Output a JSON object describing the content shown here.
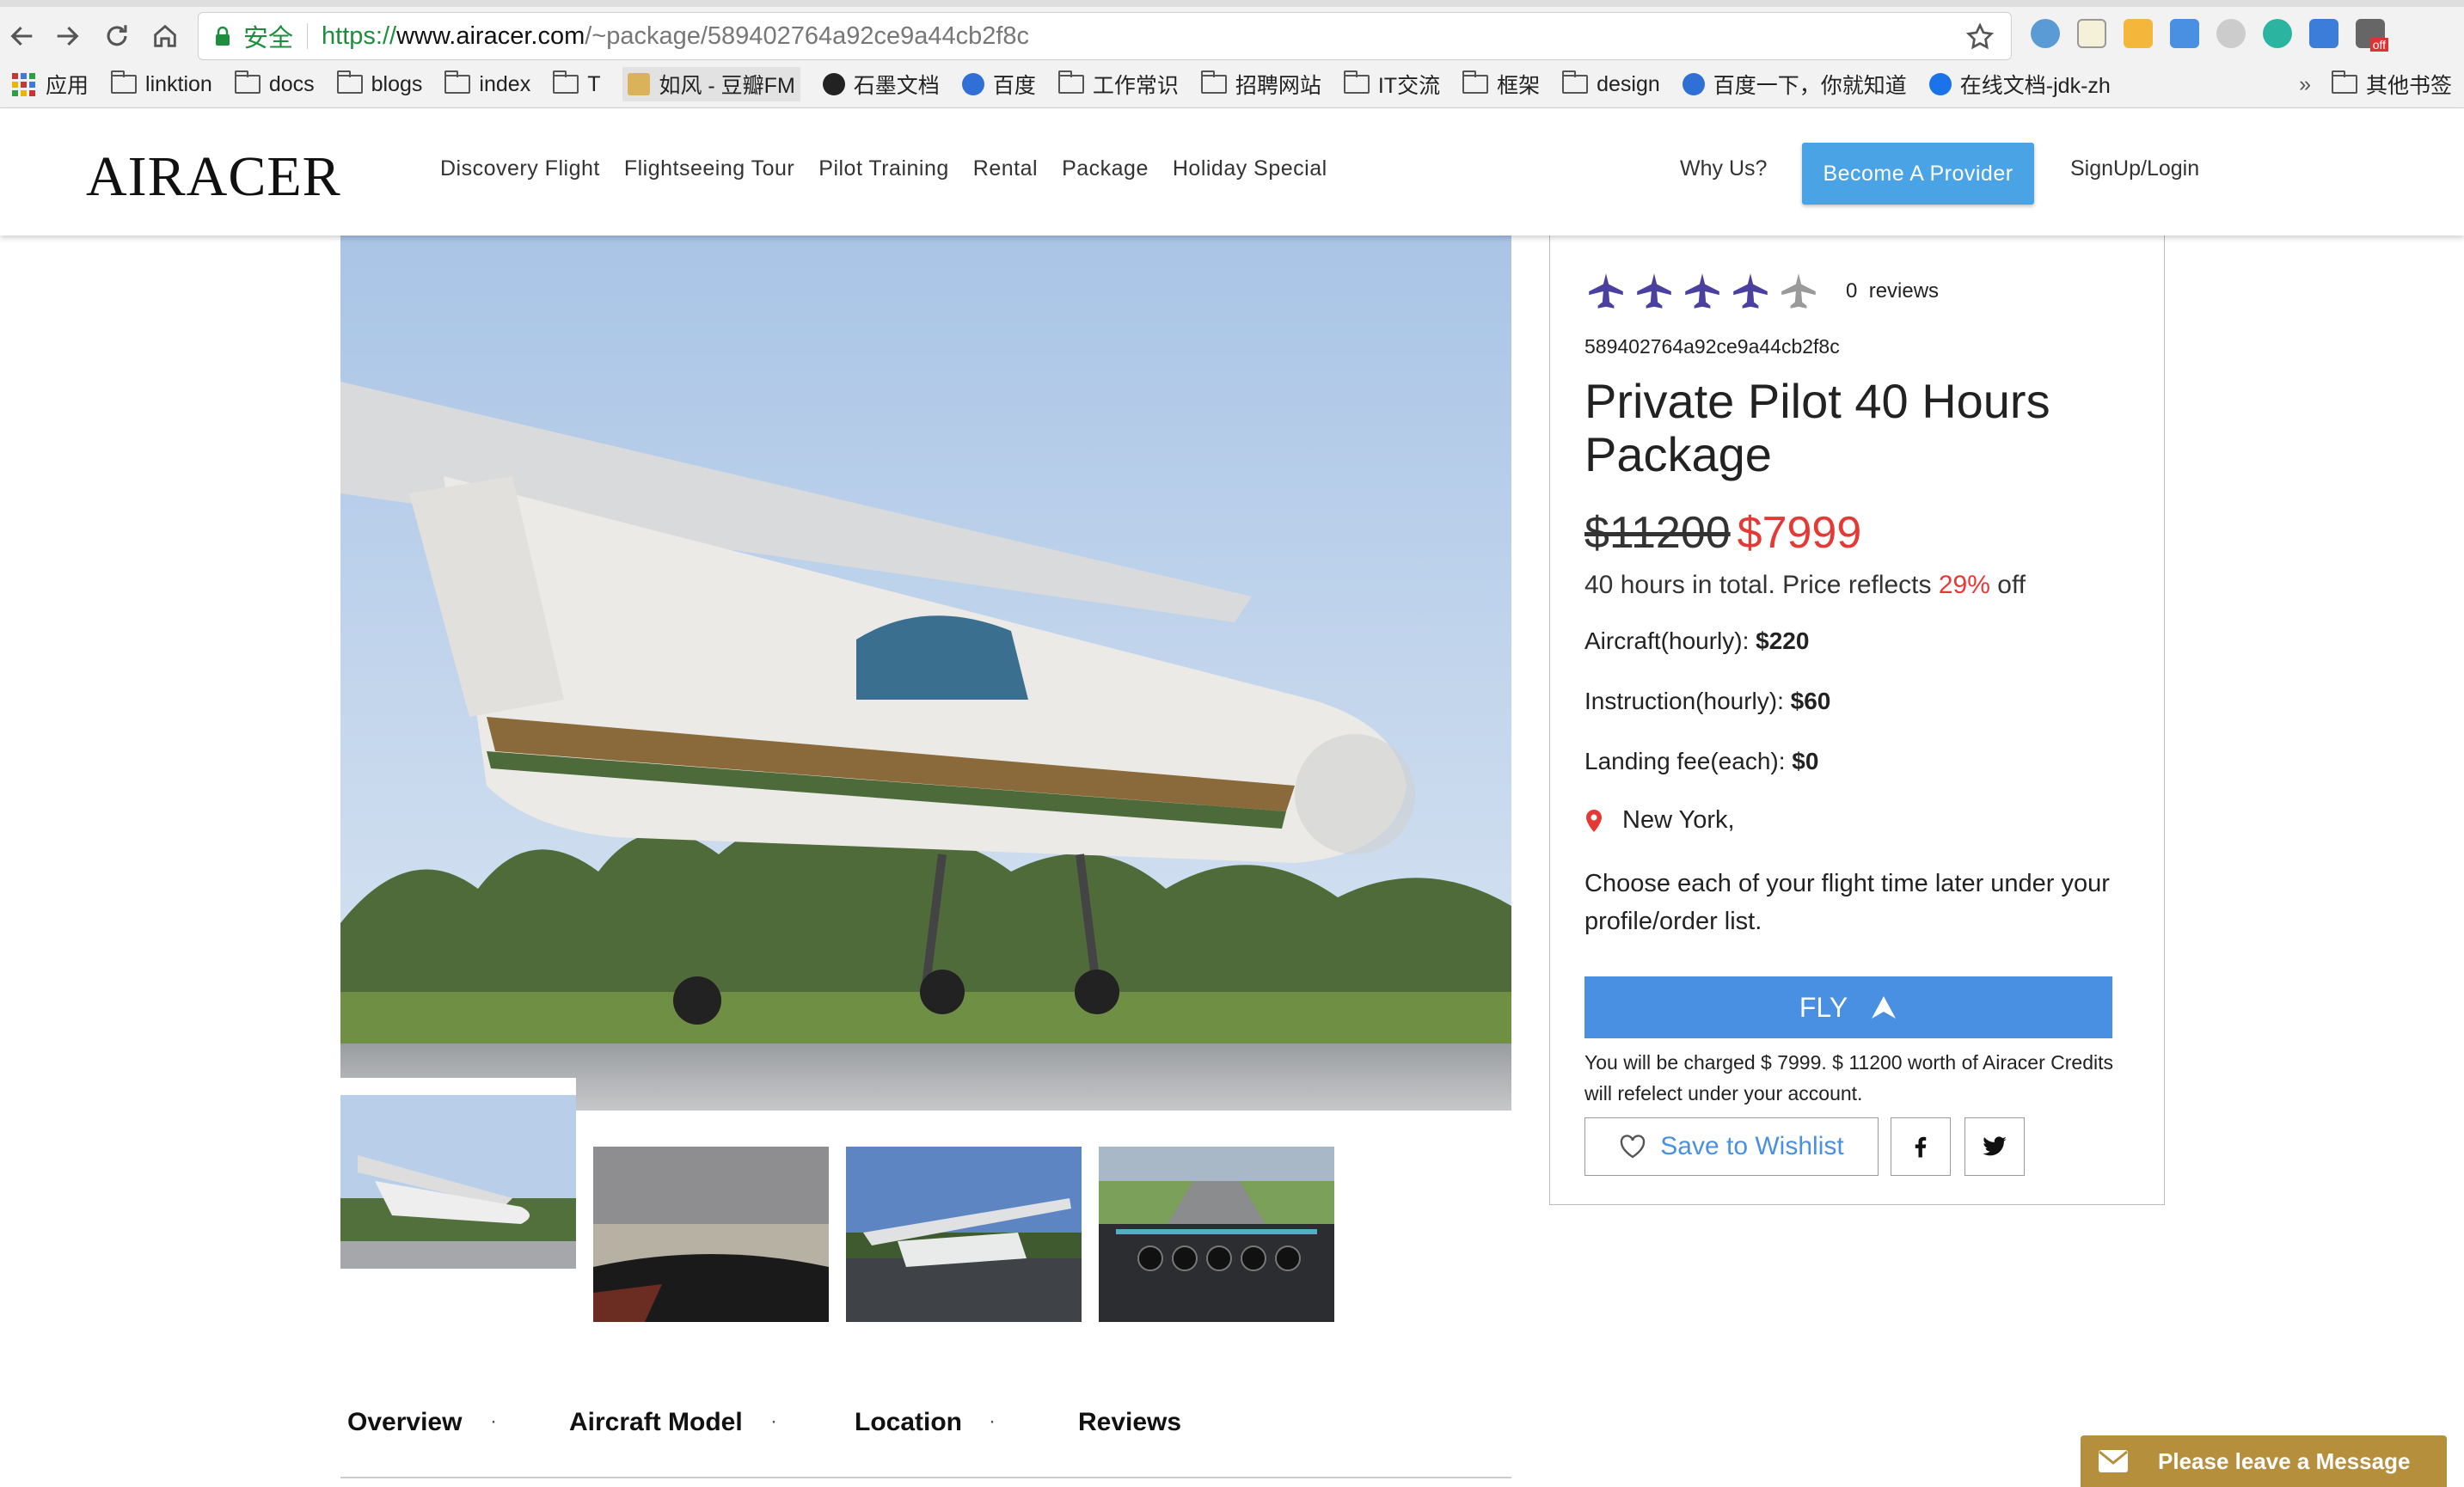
{
  "browser": {
    "secure_label": "安全",
    "url_scheme": "https://",
    "url_host": "www.airacer.com",
    "url_path": "/~package/589402764a92ce9a44cb2f8c",
    "bookmarks": [
      "应用",
      "linktion",
      "docs",
      "blogs",
      "index",
      "T",
      "如风 - 豆瓣FM",
      "石墨文档",
      "百度",
      "工作常识",
      "招聘网站",
      "IT交流",
      "框架",
      "design",
      "百度一下，你就知道",
      "在线文档-jdk-zh"
    ],
    "bookmarks_more": "»",
    "other_bookmarks": "其他书签",
    "ext_badge": "off"
  },
  "header": {
    "logo": "AIRACER",
    "nav": [
      "Discovery Flight",
      "Flightseeing Tour",
      "Pilot Training",
      "Rental",
      "Package",
      "Holiday Special"
    ],
    "why": "Why Us?",
    "provider_button": "Become A Provider",
    "signup": "SignUp/Login"
  },
  "product": {
    "rating": 4,
    "rating_max": 5,
    "reviews_count": "0",
    "reviews_label": "reviews",
    "id": "589402764a92ce9a44cb2f8c",
    "title": "Private Pilot 40 Hours Package",
    "old_price": "$11200",
    "new_price": "$7999",
    "hours_text": "40 hours in total. Price reflects",
    "discount": "29%",
    "off_label": "off",
    "aircraft_label": "Aircraft(hourly):",
    "aircraft_value": "$220",
    "instruction_label": "Instruction(hourly):",
    "instruction_value": "$60",
    "landing_label": "Landing fee(each):",
    "landing_value": "$0",
    "location": "New York,",
    "note": "Choose each of your flight time later under your profile/order list.",
    "fly_button": "FLY",
    "charge_note": "You will be charged $ 7999. $ 11200 worth of Airacer Credits will refelect under your account.",
    "wishlist_button": "Save to Wishlist"
  },
  "tabs": [
    "Overview",
    "Aircraft Model",
    "Location",
    "Reviews"
  ],
  "tab_separator": "·",
  "message_widget": "Please leave a Message",
  "colors": {
    "accent_blue": "#4a90e2",
    "provider_blue": "#4aa3e5",
    "sale_red": "#e53935",
    "star_purple": "#4b3fa0",
    "widget_gold": "#b58f3c"
  }
}
